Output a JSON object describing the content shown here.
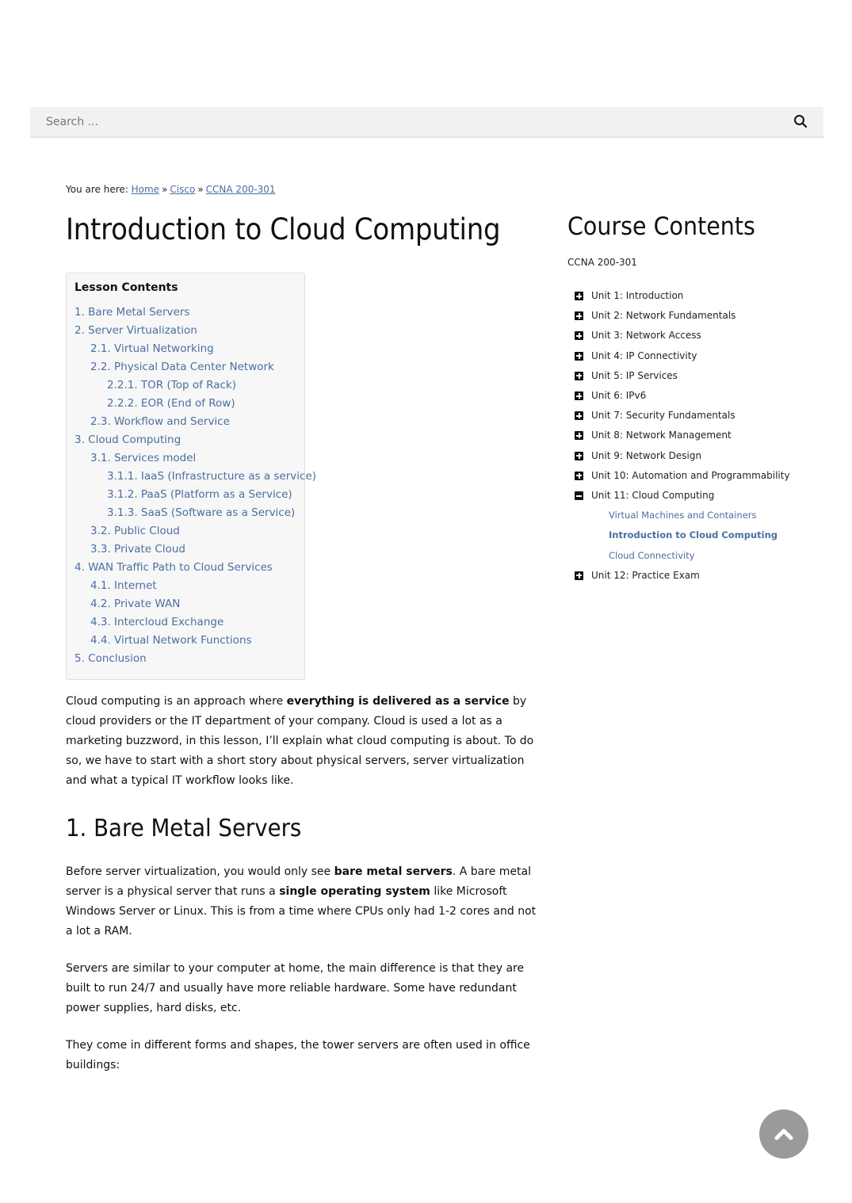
{
  "search": {
    "placeholder": "Search ...",
    "icon": "search-icon"
  },
  "breadcrumb": {
    "prefix": "You are here:",
    "separator": "»",
    "items": [
      "Home",
      "Cisco",
      "CCNA 200-301"
    ]
  },
  "page": {
    "title": "Introduction to Cloud Computing"
  },
  "lesson_contents": {
    "title": "Lesson Contents",
    "items": [
      {
        "label": "1. Bare Metal Servers",
        "level": 1
      },
      {
        "label": "2. Server Virtualization",
        "level": 1
      },
      {
        "label": "2.1. Virtual Networking",
        "level": 2
      },
      {
        "label": "2.2. Physical Data Center Network",
        "level": 2
      },
      {
        "label": "2.2.1. TOR (Top of Rack)",
        "level": 3
      },
      {
        "label": "2.2.2. EOR (End of Row)",
        "level": 3
      },
      {
        "label": "2.3. Workflow and Service",
        "level": 2
      },
      {
        "label": "3. Cloud Computing",
        "level": 1
      },
      {
        "label": "3.1. Services model",
        "level": 2
      },
      {
        "label": "3.1.1. IaaS (Infrastructure as a service)",
        "level": 3
      },
      {
        "label": "3.1.2. PaaS (Platform as a Service)",
        "level": 3
      },
      {
        "label": "3.1.3. SaaS (Software as a Service)",
        "level": 3
      },
      {
        "label": "3.2. Public Cloud",
        "level": 2
      },
      {
        "label": "3.3. Private Cloud",
        "level": 2
      },
      {
        "label": "4. WAN Traffic Path to Cloud Services",
        "level": 1
      },
      {
        "label": "4.1. Internet",
        "level": 2
      },
      {
        "label": "4.2. Private WAN",
        "level": 2
      },
      {
        "label": "4.3. Intercloud Exchange",
        "level": 2
      },
      {
        "label": "4.4. Virtual Network Functions",
        "level": 2
      },
      {
        "label": "5. Conclusion",
        "level": 1
      }
    ]
  },
  "article": {
    "intro": [
      {
        "text": "Cloud computing is an approach where ",
        "bold": false
      },
      {
        "text": "everything is delivered as a service",
        "bold": true
      },
      {
        "text": " by cloud providers or the IT department of your company. Cloud is used a lot as a marketing buzzword, in this lesson, I’ll explain what cloud computing is about. To do so, we have to start with a short story about physical servers, server virtualization and what a typical IT workflow looks like.",
        "bold": false
      }
    ],
    "section1_heading": "1. Bare Metal Servers",
    "section1_p1": [
      {
        "text": "Before server virtualization, you would only see ",
        "bold": false
      },
      {
        "text": "bare metal servers",
        "bold": true
      },
      {
        "text": ". A bare metal server is a physical server that runs a ",
        "bold": false
      },
      {
        "text": "single operating system",
        "bold": true
      },
      {
        "text": " like Microsoft Windows Server or Linux. This is from a time where CPUs only had 1-2 cores and not a lot a RAM.",
        "bold": false
      }
    ],
    "section1_p2": "Servers are similar to your computer at home, the main difference is that they are built to run 24/7 and usually have more reliable hardware. Some have redundant power supplies, hard disks, etc.",
    "section1_p3": "They come in different forms and shapes, the tower servers are often used in office buildings:"
  },
  "sidebar": {
    "title": "Course Contents",
    "course": "CCNA 200-301",
    "units": [
      {
        "label": "Unit 1: Introduction",
        "expanded": false
      },
      {
        "label": "Unit 2: Network Fundamentals",
        "expanded": false
      },
      {
        "label": "Unit 3: Network Access",
        "expanded": false
      },
      {
        "label": "Unit 4: IP Connectivity",
        "expanded": false
      },
      {
        "label": "Unit 5: IP Services",
        "expanded": false
      },
      {
        "label": "Unit 6: IPv6",
        "expanded": false
      },
      {
        "label": "Unit 7: Security Fundamentals",
        "expanded": false
      },
      {
        "label": "Unit 8: Network Management",
        "expanded": false
      },
      {
        "label": "Unit 9: Network Design",
        "expanded": false
      },
      {
        "label": "Unit 10: Automation and Programmability",
        "expanded": false
      },
      {
        "label": "Unit 11: Cloud Computing",
        "expanded": true,
        "lessons": [
          {
            "label": "Virtual Machines and Containers",
            "current": false
          },
          {
            "label": "Introduction to Cloud Computing",
            "current": true
          },
          {
            "label": "Cloud Connectivity",
            "current": false
          }
        ]
      },
      {
        "label": "Unit 12: Practice Exam",
        "expanded": false
      }
    ]
  },
  "back_to_top": {
    "icon": "chevron-up-icon"
  },
  "colors": {
    "link": "#4a6fa0",
    "search_bg": "#f1f1f1",
    "toc_bg": "#f7f7f7",
    "back_to_top_bg": "#9a9a9a"
  }
}
